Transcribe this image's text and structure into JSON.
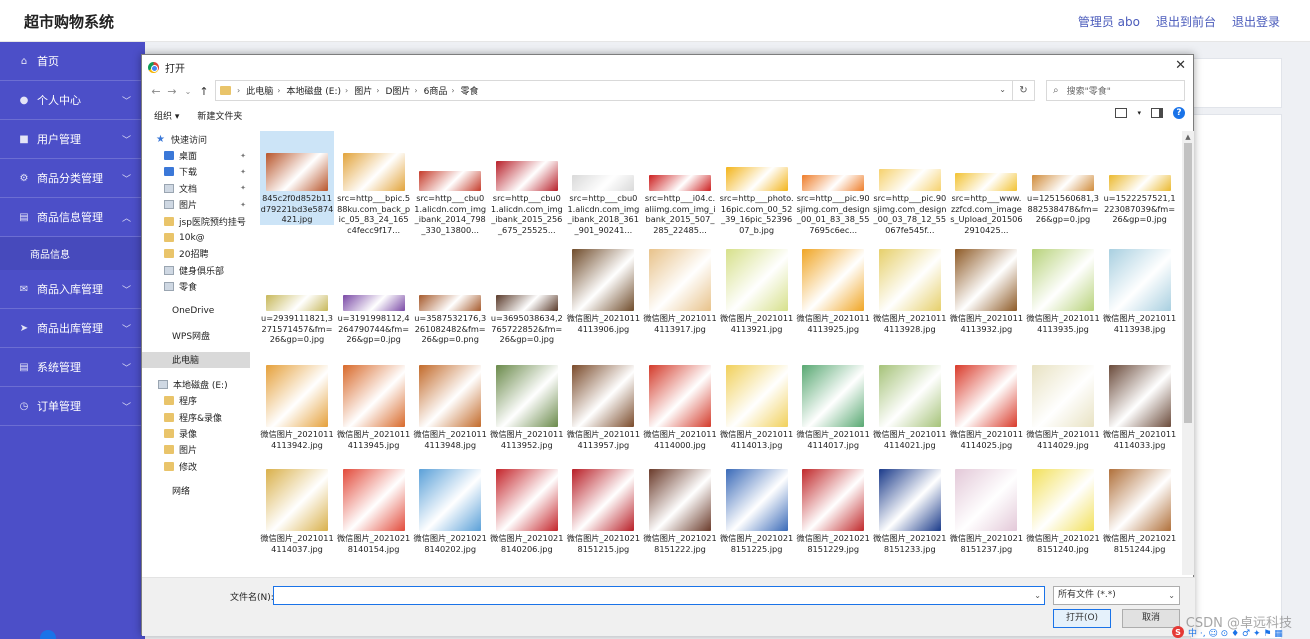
{
  "app": {
    "title": "超市购物系统",
    "header_links": [
      "管理员 abo",
      "退出到前台",
      "退出登录"
    ]
  },
  "sidebar": {
    "items": [
      {
        "label": "首页",
        "icon": "home-icon",
        "chevron": false
      },
      {
        "label": "个人中心",
        "icon": "user-icon",
        "chevron": true
      },
      {
        "label": "用户管理",
        "icon": "users-icon",
        "chevron": true
      },
      {
        "label": "商品分类管理",
        "icon": "gear-icon",
        "chevron": true
      },
      {
        "label": "商品信息管理",
        "icon": "list-icon",
        "chevron": true,
        "expanded": true,
        "sub": [
          "商品信息"
        ]
      },
      {
        "label": "商品入库管理",
        "icon": "mail-icon",
        "chevron": true
      },
      {
        "label": "商品出库管理",
        "icon": "send-icon",
        "chevron": true
      },
      {
        "label": "系统管理",
        "icon": "list-icon",
        "chevron": true
      },
      {
        "label": "订单管理",
        "icon": "clock-icon",
        "chevron": true
      }
    ]
  },
  "dialog": {
    "title": "打开",
    "close": "✕",
    "path": [
      "此电脑",
      "本地磁盘 (E:)",
      "图片",
      "D图片",
      "6商品",
      "零食"
    ],
    "search_placeholder": "搜索\"零食\"",
    "toolbar": {
      "organize": "组织 ▾",
      "new_folder": "新建文件夹"
    },
    "nav": [
      {
        "label": "快速访问",
        "icon": "star",
        "indent": 14
      },
      {
        "label": "桌面",
        "icon": "b",
        "indent": 22,
        "pin": true
      },
      {
        "label": "下载",
        "icon": "b",
        "indent": 22,
        "pin": true
      },
      {
        "label": "文档",
        "icon": "g",
        "indent": 22,
        "pin": true
      },
      {
        "label": "图片",
        "icon": "g",
        "indent": 22,
        "pin": true
      },
      {
        "label": "jsp医院预约挂号",
        "icon": "y",
        "indent": 22
      },
      {
        "label": "10k@",
        "icon": "y",
        "indent": 22
      },
      {
        "label": "20招聘",
        "icon": "y",
        "indent": 22
      },
      {
        "label": "健身俱乐部",
        "icon": "g",
        "indent": 22
      },
      {
        "label": "零食",
        "icon": "g",
        "indent": 22
      },
      {
        "label": "OneDrive",
        "icon": "none",
        "indent": 30,
        "gap": true
      },
      {
        "label": "WPS网盘",
        "icon": "none",
        "indent": 30,
        "gap": true
      },
      {
        "label": "此电脑",
        "icon": "none",
        "indent": 30,
        "gap": true,
        "selected": true
      },
      {
        "label": "本地磁盘 (E:)",
        "icon": "g",
        "indent": 16,
        "gap": true
      },
      {
        "label": "程序",
        "icon": "y",
        "indent": 22
      },
      {
        "label": "程序&录像",
        "icon": "y",
        "indent": 22
      },
      {
        "label": "录像",
        "icon": "y",
        "indent": 22
      },
      {
        "label": "图片",
        "icon": "y",
        "indent": 22
      },
      {
        "label": "修改",
        "icon": "y",
        "indent": 22
      },
      {
        "label": "网络",
        "icon": "none",
        "indent": 30,
        "gap": true
      }
    ],
    "files": [
      {
        "name": "845c2f0d852b11d79221bd3e5874421.jpg",
        "color": "#b8552b",
        "thumb_h": 38,
        "selected": true
      },
      {
        "name": "src=http___bpic.588ku.com_back_pic_05_83_24_165c4fecc9f17...",
        "color": "#e2a33a",
        "thumb_h": 38
      },
      {
        "name": "src=http___cbu01.alicdn.com_img_ibank_2014_798_330_13800...",
        "color": "#c53b2a",
        "thumb_h": 20
      },
      {
        "name": "src=http___cbu01.alicdn.com_img_ibank_2015_256_675_25525...",
        "color": "#b8202a",
        "thumb_h": 30
      },
      {
        "name": "src=http___cbu01.alicdn.com_img_ibank_2018_361_901_90241...",
        "color": "#d9d9d9",
        "thumb_h": 16
      },
      {
        "name": "src=http___i04.c.aliimg.com_img_ibank_2015_507_285_22485...",
        "color": "#cc1f1f",
        "thumb_h": 16
      },
      {
        "name": "src=http___photo.16pic.com_00_52_39_16pic_5239607_b.jpg",
        "color": "#f3b41a",
        "thumb_h": 24
      },
      {
        "name": "src=http___pic.90sjimg.com_design_00_01_83_38_557695c6ec...",
        "color": "#ee7d2a",
        "thumb_h": 16
      },
      {
        "name": "src=http___pic.90sjimg.com_design_00_03_78_12_55067fe545f...",
        "color": "#f6d16c",
        "thumb_h": 22
      },
      {
        "name": "src=http___www.zzfcd.com_images_Upload_2015062910425...",
        "color": "#f2c232",
        "thumb_h": 18
      },
      {
        "name": "u=1251560681,3882538478&fm=26&gp=0.jpg",
        "color": "#d08b3a",
        "thumb_h": 16
      },
      {
        "name": "u=1522257521,1223087039&fm=26&gp=0.jpg",
        "color": "#ebb92e",
        "thumb_h": 16
      },
      {
        "name": "u=2939111821,3271571457&fm=26&gp=0.jpg",
        "color": "#c7b85a",
        "thumb_h": 16
      },
      {
        "name": "u=3191998112,4264790744&fm=26&gp=0.jpg",
        "color": "#7a49a6",
        "thumb_h": 16
      },
      {
        "name": "u=3587532176,3261082482&fm=26&gp=0.png",
        "color": "#a65a2c",
        "thumb_h": 16
      },
      {
        "name": "u=3695038634,2765722852&fm=26&gp=0.jpg",
        "color": "#5a3a2a",
        "thumb_h": 16
      },
      {
        "name": "微信图片_20210114113906.jpg",
        "color": "#6f4b2a",
        "thumb_h": 62
      },
      {
        "name": "微信图片_20210114113917.jpg",
        "color": "#e8c28a",
        "thumb_h": 62
      },
      {
        "name": "微信图片_20210114113921.jpg",
        "color": "#d6e08a",
        "thumb_h": 62
      },
      {
        "name": "微信图片_20210114113925.jpg",
        "color": "#f0a524",
        "thumb_h": 62
      },
      {
        "name": "微信图片_20210114113928.jpg",
        "color": "#e6cf6a",
        "thumb_h": 62
      },
      {
        "name": "微信图片_20210114113932.jpg",
        "color": "#8e5a26",
        "thumb_h": 62
      },
      {
        "name": "微信图片_20210114113935.jpg",
        "color": "#b7d27a",
        "thumb_h": 62
      },
      {
        "name": "微信图片_20210114113938.jpg",
        "color": "#a8cfe0",
        "thumb_h": 62
      },
      {
        "name": "微信图片_20210114113942.jpg",
        "color": "#e5a03a",
        "thumb_h": 62
      },
      {
        "name": "微信图片_20210114113945.jpg",
        "color": "#d8692a",
        "thumb_h": 62
      },
      {
        "name": "微信图片_20210114113948.jpg",
        "color": "#c26a2a",
        "thumb_h": 62
      },
      {
        "name": "微信图片_20210114113952.jpg",
        "color": "#6a8a4a",
        "thumb_h": 62
      },
      {
        "name": "微信图片_20210114113957.jpg",
        "color": "#7a4a2a",
        "thumb_h": 62
      },
      {
        "name": "微信图片_20210114114000.jpg",
        "color": "#d33a2a",
        "thumb_h": 62
      },
      {
        "name": "微信图片_20210114114013.jpg",
        "color": "#f1d05a",
        "thumb_h": 62
      },
      {
        "name": "微信图片_20210114114017.jpg",
        "color": "#58a872",
        "thumb_h": 62
      },
      {
        "name": "微信图片_20210114114021.jpg",
        "color": "#a5c278",
        "thumb_h": 62
      },
      {
        "name": "微信图片_20210114114025.jpg",
        "color": "#d93a2a",
        "thumb_h": 62
      },
      {
        "name": "微信图片_20210114114029.jpg",
        "color": "#e8e2c2",
        "thumb_h": 62
      },
      {
        "name": "微信图片_20210114114033.jpg",
        "color": "#6a4a3a",
        "thumb_h": 62
      },
      {
        "name": "微信图片_20210114114037.jpg",
        "color": "#d9b04a",
        "thumb_h": 62
      },
      {
        "name": "微信图片_20210218140154.jpg",
        "color": "#e24a3a",
        "thumb_h": 62
      },
      {
        "name": "微信图片_20210218140202.jpg",
        "color": "#5aa0d8",
        "thumb_h": 62
      },
      {
        "name": "微信图片_20210218140206.jpg",
        "color": "#c4242a",
        "thumb_h": 62
      },
      {
        "name": "微信图片_20210218151215.jpg",
        "color": "#b81e26",
        "thumb_h": 62
      },
      {
        "name": "微信图片_20210218151222.jpg",
        "color": "#6a3a2a",
        "thumb_h": 62
      },
      {
        "name": "微信图片_20210218151225.jpg",
        "color": "#3a6ab8",
        "thumb_h": 62
      },
      {
        "name": "微信图片_20210218151229.jpg",
        "color": "#c0282a",
        "thumb_h": 62
      },
      {
        "name": "微信图片_20210218151233.jpg",
        "color": "#1a3a8a",
        "thumb_h": 62
      },
      {
        "name": "微信图片_20210218151237.jpg",
        "color": "#e3c8d8",
        "thumb_h": 62
      },
      {
        "name": "微信图片_20210218151240.jpg",
        "color": "#f2e05a",
        "thumb_h": 62
      },
      {
        "name": "微信图片_20210218151244.jpg",
        "color": "#b0703a",
        "thumb_h": 62
      }
    ],
    "filename_label": "文件名(N):",
    "filename_value": "",
    "filetype": "所有文件 (*.*)",
    "open_button": "打开(O)",
    "cancel_button": "取消"
  },
  "watermark": "CSDN @卓远科技",
  "tray_text": "中 ·, ☺ ⊙ ♦ ♂ ✦ ⚑ ▦"
}
